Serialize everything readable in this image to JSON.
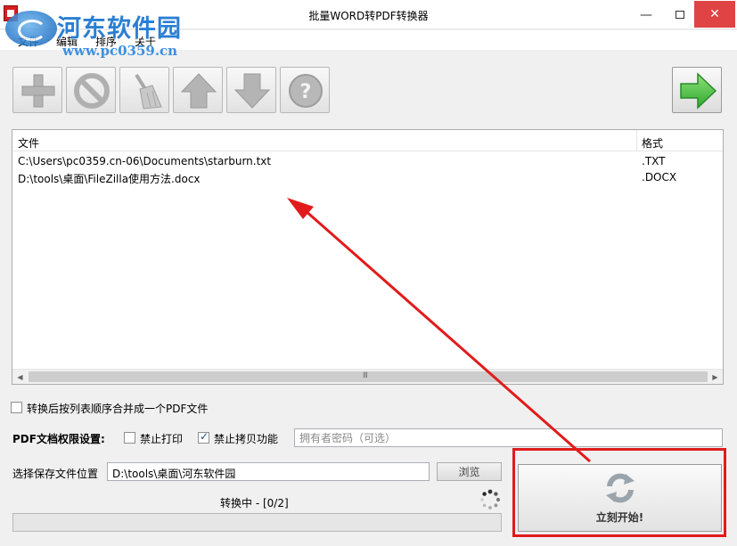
{
  "window": {
    "title": "批量WORD转PDF转换器",
    "minimize_glyph": "—",
    "close_glyph": "✕"
  },
  "watermark": {
    "site_name": "河东软件园",
    "url": "www.pc0359.cn"
  },
  "menu": {
    "items": [
      "文件",
      "编辑",
      "排序",
      "关于"
    ]
  },
  "toolbar": {
    "buttons": [
      {
        "icon": "add-icon",
        "enabled": false
      },
      {
        "icon": "remove-icon",
        "enabled": false
      },
      {
        "icon": "clear-broom-icon",
        "enabled": false
      },
      {
        "icon": "move-up-icon",
        "enabled": false
      },
      {
        "icon": "move-down-icon",
        "enabled": false
      },
      {
        "icon": "help-icon",
        "enabled": false
      }
    ],
    "convert_icon": "go-arrow-icon"
  },
  "file_list": {
    "columns": [
      "文件",
      "格式"
    ],
    "rows": [
      {
        "path": "C:\\Users\\pc0359.cn-06\\Documents\\starburn.txt",
        "format": ".TXT"
      },
      {
        "path": "D:\\tools\\桌面\\FileZilla使用方法.docx",
        "format": ".DOCX"
      }
    ],
    "scroll_grip": "III"
  },
  "options": {
    "merge_label": "转换后按列表顺序合并成一个PDF文件",
    "merge_checked": false,
    "permissions_label": "PDF文档权限设置:",
    "no_print_label": "禁止打印",
    "no_print_checked": false,
    "no_copy_label": "禁止拷贝功能",
    "no_copy_checked": true,
    "owner_password_placeholder": "拥有者密码（可选）",
    "save_location_label": "选择保存文件位置",
    "save_location_value": "D:\\tools\\桌面\\河东软件园",
    "browse_label": "浏览"
  },
  "status": {
    "text": "转换中 - [0/2]",
    "progress": 0
  },
  "start_button": {
    "label": "立刻开始!",
    "icon": "refresh-icon"
  },
  "colors": {
    "annotation_red": "#e11b1b",
    "go_green": "#3cb43c",
    "watermark_blue": "#2a7fd4"
  }
}
